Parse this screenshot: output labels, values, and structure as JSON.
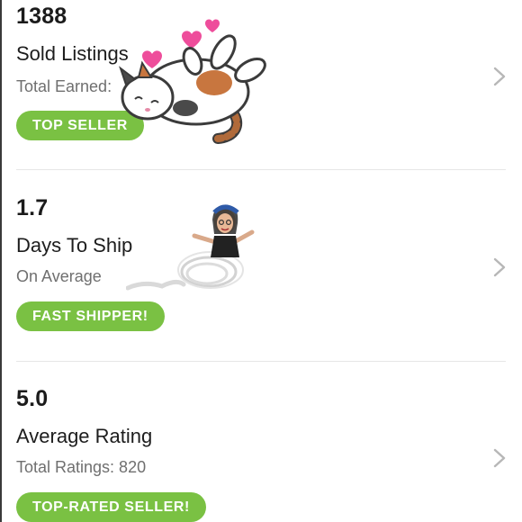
{
  "stats": [
    {
      "value": "1388",
      "title": "Sold Listings",
      "subtitle": "Total Earned:",
      "badge": "TOP SELLER",
      "sticker_icon": "sleeping-cat-icon"
    },
    {
      "value": "1.7",
      "title": "Days To Ship",
      "subtitle": "On Average",
      "badge": "FAST SHIPPER!",
      "sticker_icon": "running-avatar-icon"
    },
    {
      "value": "5.0",
      "title": "Average Rating",
      "subtitle": "Total Ratings: 820",
      "badge": "TOP-RATED SELLER!"
    }
  ],
  "colors": {
    "badge": "#7ac143",
    "heart": "#ee4d9b",
    "chevron": "#b7b7b7"
  }
}
